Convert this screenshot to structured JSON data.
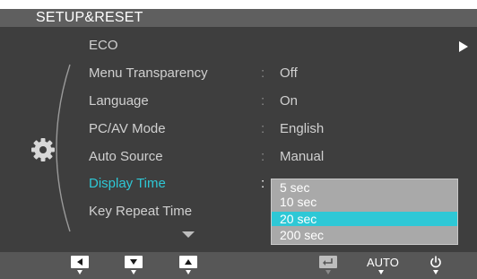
{
  "menu": {
    "title": "SETUP&RESET",
    "items": [
      {
        "label": "ECO",
        "value": ""
      },
      {
        "label": "Menu Transparency",
        "value": "Off"
      },
      {
        "label": "Language",
        "value": "On"
      },
      {
        "label": "PC/AV Mode",
        "value": "English"
      },
      {
        "label": "Auto Source",
        "value": "Manual"
      },
      {
        "label": "Display Time",
        "value": ""
      },
      {
        "label": "Key Repeat Time",
        "value": ""
      }
    ],
    "separator": ":",
    "active_index": 5
  },
  "dropdown": {
    "options": [
      "5 sec",
      "10 sec",
      "20 sec",
      "200 sec"
    ],
    "selected": "20 sec"
  },
  "bottom_bar": {
    "auto_label": "AUTO"
  },
  "colors": {
    "accent": "#2ec8d6",
    "background": "#3e3e3e",
    "title_bar": "#5f5f5f",
    "bottom_bar": "#575757",
    "dropdown": "#a9a9a9"
  },
  "icons": [
    "gear-icon",
    "play-arrow-icon",
    "scroll-down-icon",
    "left-icon",
    "down-icon",
    "up-icon",
    "return-icon",
    "power-icon"
  ]
}
